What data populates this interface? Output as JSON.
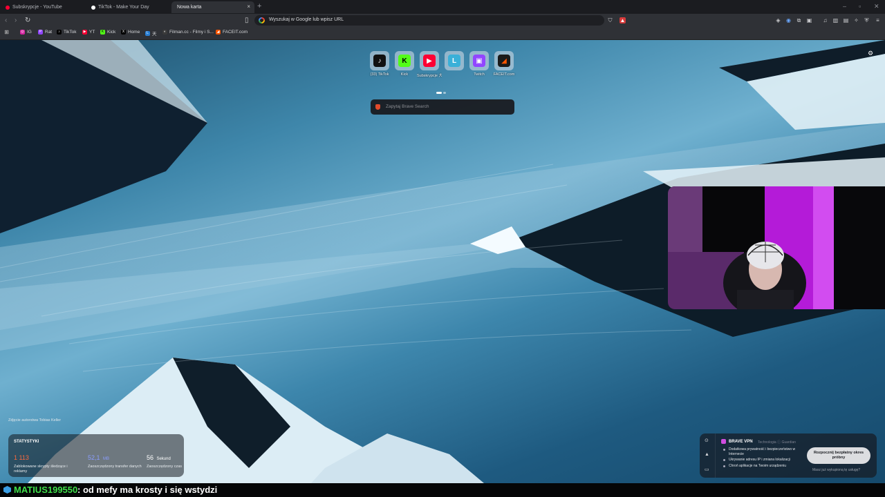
{
  "tabs": [
    {
      "title": "Subskrypcje - YouTube",
      "color": "#ff0033",
      "active": false
    },
    {
      "title": "TikTok - Make Your Day",
      "color": "#ffffff",
      "active": false
    },
    {
      "title": "Nowa karta",
      "color": "",
      "active": true
    }
  ],
  "tab_close": "×",
  "new_tab": "+",
  "window": {
    "minimize": "–",
    "maximize": "▫",
    "close": "✕"
  },
  "address": {
    "placeholder": "Wyszukaj w Google lub wpisz URL"
  },
  "bookmarks": [
    {
      "label": "IG",
      "color": "#d6249f",
      "glyph": "◎"
    },
    {
      "label": "Rat",
      "color": "#9146ff",
      "glyph": "P"
    },
    {
      "label": "TikTok",
      "color": "#000000",
      "glyph": "♪"
    },
    {
      "label": "YT",
      "color": "#ff0033",
      "glyph": "▶"
    },
    {
      "label": "Kick",
      "color": "#53fc18",
      "glyph": "K"
    },
    {
      "label": "Home",
      "color": "#000000",
      "glyph": "X"
    },
    {
      "label": "天",
      "color": "#2a7fd4",
      "glyph": "L"
    },
    {
      "label": "Filman.cc - Filmy i S...",
      "color": "#3a3a3a",
      "glyph": "◐"
    },
    {
      "label": "FACEIT.com",
      "color": "#ff5500",
      "glyph": "◢"
    }
  ],
  "top_sites": [
    {
      "label": "(33) TikTok",
      "color": "#111111",
      "glyph": "♪"
    },
    {
      "label": "Kick",
      "color": "#53fc18",
      "glyph": "K"
    },
    {
      "label": "Subskrypcje 大上天 Fill...",
      "color": "#ff0033",
      "glyph": "▶"
    },
    {
      "label": "",
      "color": "#3ab0d8",
      "glyph": "L"
    },
    {
      "label": "Twitch",
      "color": "#9146ff",
      "glyph": "▣"
    },
    {
      "label": "FACEIT.com",
      "color": "#1a1a1a",
      "glyph": "◢"
    }
  ],
  "search": {
    "placeholder": "Zapytaj Brave Search"
  },
  "photo_credit": "Zdjęcie autorstwa Tobias Keller",
  "stats": {
    "heading": "STATYSTYKI",
    "items": [
      {
        "value": "1 113",
        "unit": "",
        "desc": "Zablokowane skrypty śledzące i reklamy",
        "color": "#ff6a3d"
      },
      {
        "value": "52,1",
        "unit": "MB",
        "desc": "Zaoszczędzony transfer danych",
        "color": "#8a9dff"
      },
      {
        "value": "56",
        "unit": "Sekund",
        "desc": "Zaoszczędzony czas",
        "color": "#ffffff"
      }
    ]
  },
  "vpn": {
    "title": "BRAVE VPN",
    "subtitle": "Technologia ⓘ Guardian",
    "bullets": [
      "Dodatkowa prywatność i bezpieczeństwo w Internecie",
      "Ukrywanie adresu IP i zmiana lokalizacji",
      "Chroń aplikacje na Twoim urządzeniu"
    ],
    "cta": "Rozpocznij bezpłatny okres próbny",
    "later": "Masz już wykupioną tę usługę?"
  },
  "chat": {
    "user": "MATIUS199550",
    "message": ": od mefy ma krosty i się wstydzi"
  }
}
